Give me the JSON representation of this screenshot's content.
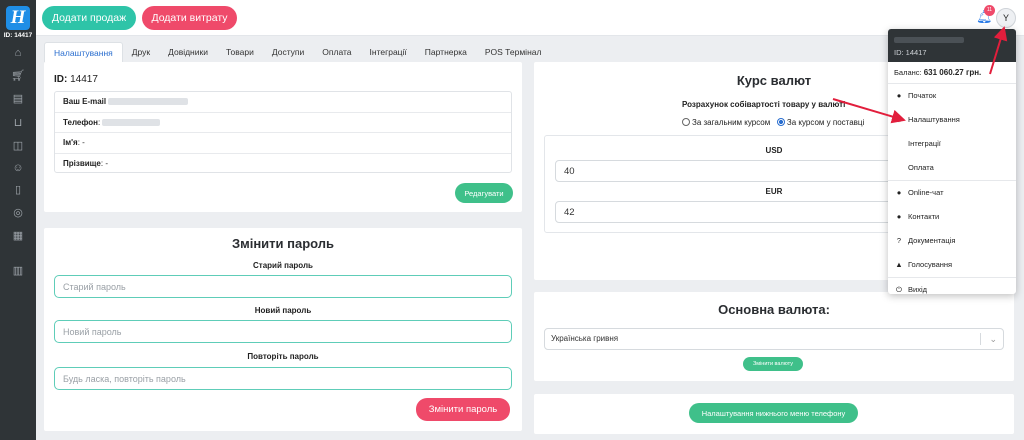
{
  "sidebar": {
    "logo": "H",
    "id_label": "ID: 14417",
    "icons": [
      "home-icon",
      "cart-icon",
      "cash-icon",
      "basket-icon",
      "box-icon",
      "users-icon",
      "clipboard-icon",
      "coins-icon",
      "calendar-icon",
      "bank-icon"
    ]
  },
  "topbar": {
    "add_sale": "Додати продаж",
    "add_expense": "Додати витрату",
    "notif_count": "11",
    "avatar_letter": "Y"
  },
  "tabs": [
    "Налаштування",
    "Друк",
    "Довідники",
    "Товари",
    "Доступи",
    "Оплата",
    "Інтеграції",
    "Партнерка",
    "POS Термінал"
  ],
  "profile": {
    "id_label": "ID:",
    "id_value": "14417",
    "rows": [
      {
        "label": "Ваш E-mail",
        "value": ""
      },
      {
        "label": "Телефон",
        "value": ""
      },
      {
        "label": "Ім'я",
        "value": "-"
      },
      {
        "label": "Прізвище",
        "value": "-"
      }
    ],
    "edit_button": "Редагувати"
  },
  "password": {
    "title": "Змінити пароль",
    "old_label": "Старий пароль",
    "old_placeholder": "Старий пароль",
    "new_label": "Новий пароль",
    "new_placeholder": "Новий пароль",
    "repeat_label": "Повторіть пароль",
    "repeat_placeholder": "Будь ласка, повторіть пароль",
    "submit": "Змінити пароль"
  },
  "rates": {
    "title": "Курс валют",
    "subtitle": "Розрахунок собівартості товару у валюті",
    "option_general": "За загальним курсом",
    "option_supply": "За курсом у поставці",
    "selected": "supply",
    "usd_label": "USD",
    "usd_value": "40",
    "eur_label": "EUR",
    "eur_value": "42"
  },
  "currency": {
    "title": "Основна валюта:",
    "selected": "Українська гривня",
    "button": "Змінити валюту"
  },
  "mobile_menu": {
    "button": "Налаштування нижнього меню телефону"
  },
  "dropdown": {
    "id_label": "ID: 14417",
    "balance_label": "Баланс:",
    "balance_value": "631 060.27 грн.",
    "items": [
      {
        "label": "Початок",
        "icon": "bulb-icon"
      },
      {
        "label": "Налаштування",
        "icon": "gear-icon"
      },
      {
        "label": "Інтеграції",
        "icon": ""
      },
      {
        "label": "Оплата",
        "icon": ""
      },
      {
        "label": "Online-чат",
        "icon": "user-icon"
      },
      {
        "label": "Контакти",
        "icon": "chat-icon"
      },
      {
        "label": "Документація",
        "icon": "question-icon"
      },
      {
        "label": "Голосування",
        "icon": "thumbs-up-icon"
      },
      {
        "label": "Вихід",
        "icon": "power-icon"
      }
    ]
  },
  "colors": {
    "teal": "#2ec4a8",
    "red": "#ef4a6a",
    "green": "#3fc08a",
    "sidebar": "#2f3437",
    "active_tab": "#2a6ecf",
    "annotation": "#e21e3c"
  }
}
